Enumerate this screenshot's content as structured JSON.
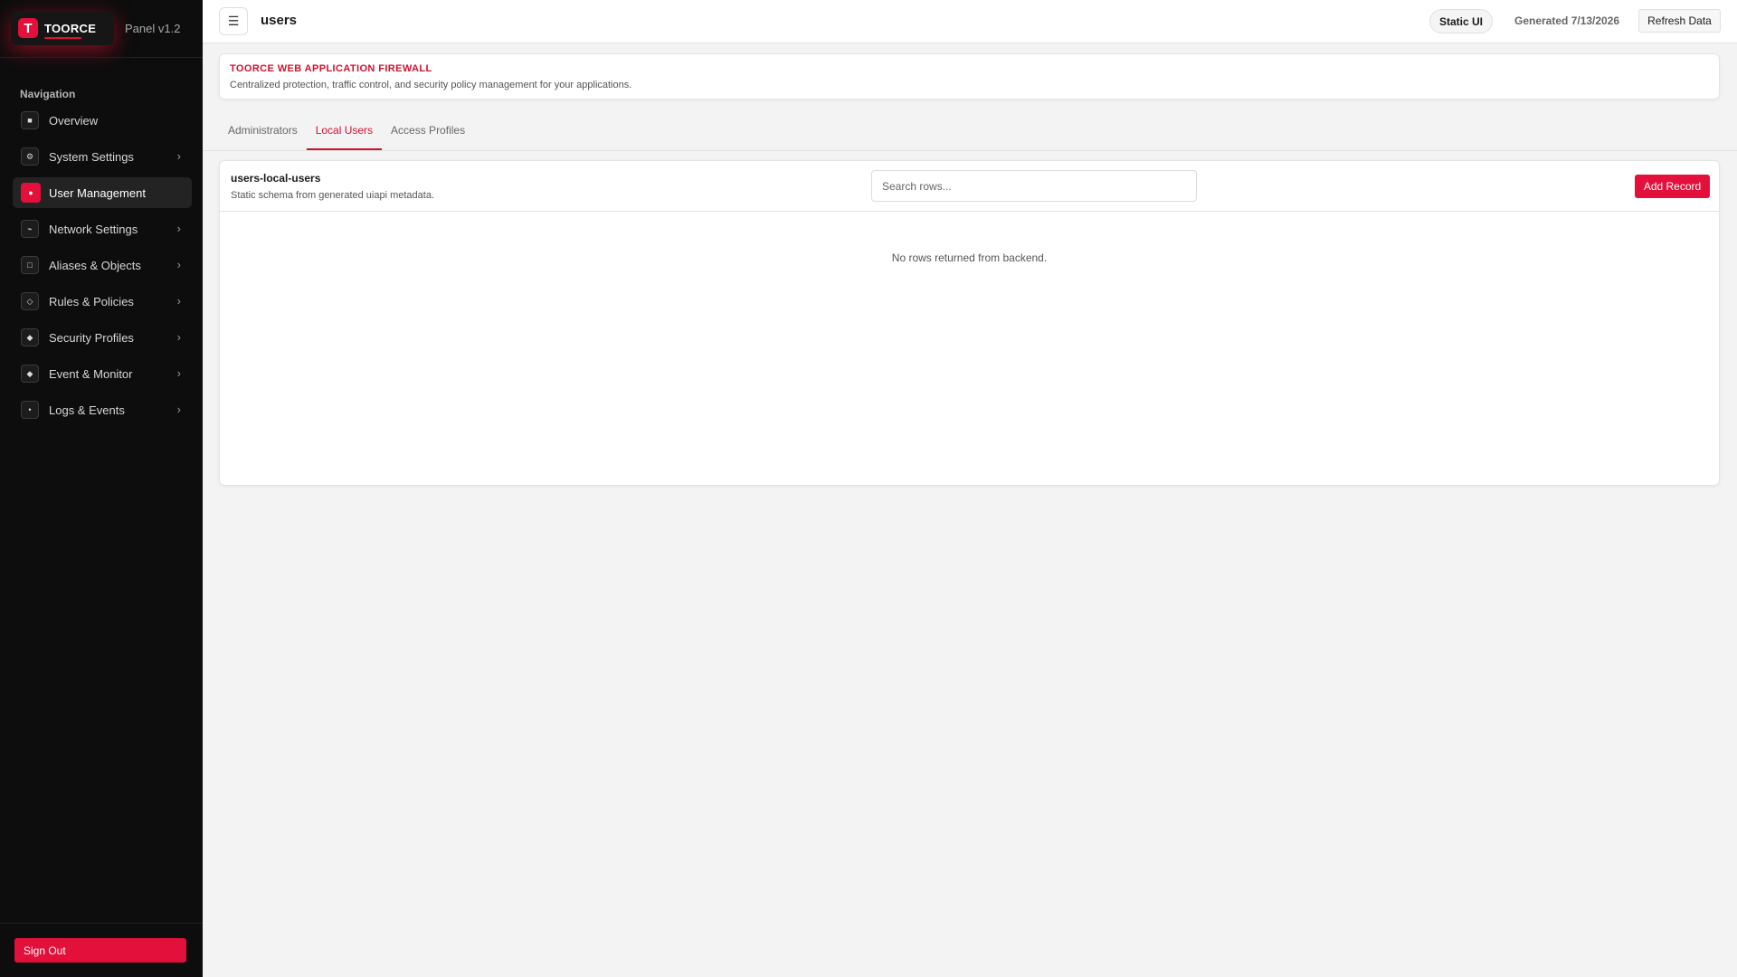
{
  "brand": {
    "logo_letter": "T",
    "name": "TOORCE",
    "version": "Panel v1.2"
  },
  "sidebar": {
    "heading": "Navigation",
    "items": [
      {
        "label": "Overview",
        "icon": "grid-icon",
        "glyph": "■",
        "has_children": false,
        "active": false
      },
      {
        "label": "System Settings",
        "icon": "gear-icon",
        "glyph": "⚙",
        "has_children": true,
        "active": false
      },
      {
        "label": "User Management",
        "icon": "user-icon",
        "glyph": "●",
        "has_children": false,
        "active": true
      },
      {
        "label": "Network Settings",
        "icon": "network-icon",
        "glyph": "⌁",
        "has_children": true,
        "active": false
      },
      {
        "label": "Aliases & Objects",
        "icon": "square-icon",
        "glyph": "□",
        "has_children": true,
        "active": false
      },
      {
        "label": "Rules & Policies",
        "icon": "diamond-outline-icon",
        "glyph": "◇",
        "has_children": true,
        "active": false
      },
      {
        "label": "Security Profiles",
        "icon": "diamond-icon",
        "glyph": "◆",
        "has_children": true,
        "active": false
      },
      {
        "label": "Event & Monitor",
        "icon": "diamond-icon",
        "glyph": "◆",
        "has_children": true,
        "active": false
      },
      {
        "label": "Logs & Events",
        "icon": "dot-icon",
        "glyph": "•",
        "has_children": true,
        "active": false
      }
    ],
    "chevron": "›",
    "sign_out": "Sign Out"
  },
  "topbar": {
    "menu_glyph": "☰",
    "title": "users",
    "mode_pill": "Static UI",
    "generated": "Generated 7/13/2026",
    "refresh": "Refresh Data"
  },
  "banner": {
    "title": "TOORCE WEB APPLICATION FIREWALL",
    "subtitle": "Centralized protection, traffic control, and security policy management for your applications."
  },
  "tabs": [
    {
      "label": "Administrators",
      "active": false
    },
    {
      "label": "Local Users",
      "active": true
    },
    {
      "label": "Access Profiles",
      "active": false
    }
  ],
  "table": {
    "title": "users-local-users",
    "subtitle": "Static schema from generated uiapi metadata.",
    "search_placeholder": "Search rows...",
    "add_label": "Add Record",
    "empty_message": "No rows returned from backend."
  },
  "colors": {
    "accent": "#e2103a",
    "sidebar_bg": "#0d0d0d",
    "page_bg": "#f3f3f3"
  }
}
